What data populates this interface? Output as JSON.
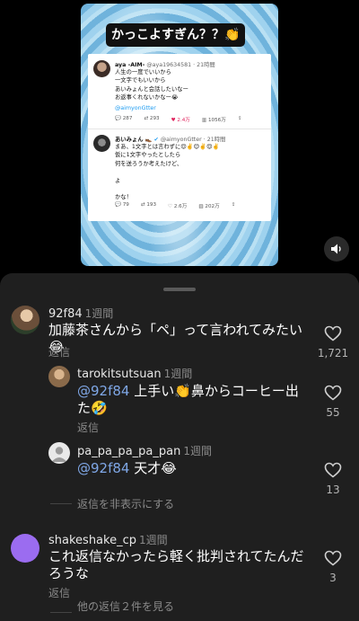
{
  "video": {
    "title": "かっこよすぎん？？👏",
    "tweet1": {
      "name": "aya -AIM-",
      "handle": "@aya19634581 · 21時間",
      "body": "人生の一度でいいから\n一文字でもいいから\nあいみょんと会話したいなー\nお返事くれないかなー😭",
      "link": "@aimyonGtter",
      "reply_count": "287",
      "retweet_count": "293",
      "like_count": "2.4万",
      "view_count": "1056万"
    },
    "tweet2": {
      "name": "あいみょん 👞",
      "handle": "@aimyonGtter · 21時間",
      "body": "まあ、1文字とは言わずに😌✌️😌✌️😌✌️\n仮に1文字やったとしたら\n何を送ろうか考えたけど、\n\nよ\n\nかな！",
      "reply_count": "79",
      "retweet_count": "193",
      "like_count": "2.6万",
      "view_count": "202万"
    }
  },
  "comments": [
    {
      "username": "92f84",
      "time": "1週間",
      "text": "加藤茶さんから「ペ」って言われてみたい😂",
      "reply_label": "返信",
      "likes": "1,721"
    },
    {
      "username": "tarokitsutsuan",
      "time": "1週間",
      "mention": "@92f84",
      "text": " 上手い👏鼻からコーヒー出た🤣",
      "reply_label": "返信",
      "likes": "55"
    },
    {
      "username": "pa_pa_pa_pa_pan",
      "time": "1週間",
      "mention": "@92f84",
      "text": " 天才😂",
      "reply_label": "返信",
      "likes": "13"
    },
    {
      "username": "shakeshake_cp",
      "time": "1週間",
      "text": "これ返信なかったら軽く批判されてたんだろうな",
      "reply_label": "返信",
      "likes": "3"
    }
  ],
  "hide_replies_label": "返信を非表示にする",
  "more_replies_label": "他の返信２件を見る",
  "colors": {
    "sheet_bg": "#1f1f1f",
    "mention": "#7fa7e6",
    "purple_avatar": "#9b6cf0"
  },
  "icons": [
    "speaker-icon",
    "heart-outline-icon",
    "verified-icon",
    "reply-icon",
    "retweet-icon",
    "like-icon",
    "views-icon",
    "share-icon"
  ]
}
